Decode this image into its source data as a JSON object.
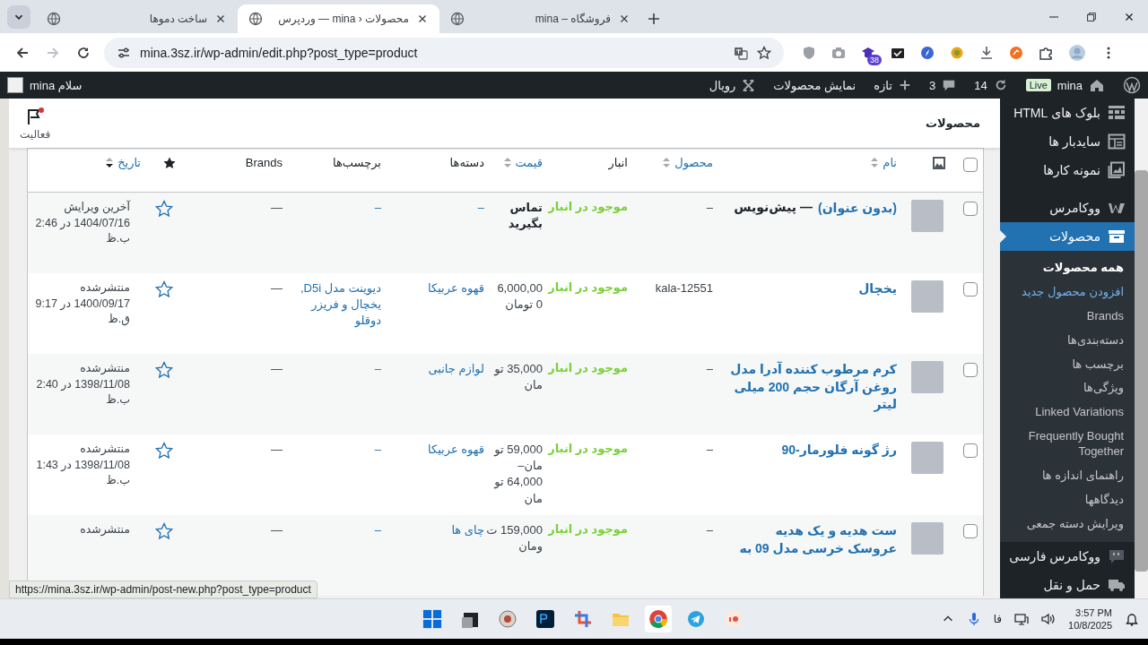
{
  "browser": {
    "tabs": [
      {
        "title": "فروشگاه – mina",
        "selected": false
      },
      {
        "title": "محصولات ‹ mina — وردپرس",
        "selected": true
      },
      {
        "title": "ساخت دموها",
        "selected": false
      }
    ],
    "url": "mina.3sz.ir/wp-admin/edit.php?post_type=product",
    "extension_badge": "38"
  },
  "admin_bar": {
    "site": "mina",
    "live": "Live",
    "updates": "14",
    "comments": "3",
    "new": "تازه",
    "view": "نمایش محصولات",
    "theme": "رویال",
    "greeting": "سلام mina"
  },
  "page": {
    "title": "محصولات",
    "activity": "فعالیت"
  },
  "table": {
    "columns": [
      {
        "kind": "checkbox",
        "checked": false
      },
      {
        "kind": "image"
      },
      {
        "kind": "sortable",
        "label": "نام"
      },
      {
        "kind": "sortable",
        "label": "محصول"
      },
      {
        "kind": "plain",
        "label": "انبار"
      },
      {
        "kind": "sortable",
        "label": "قیمت"
      },
      {
        "kind": "plain",
        "label": "دسته‌ها"
      },
      {
        "kind": "plain",
        "label": "برچسب‌ها"
      },
      {
        "kind": "plain",
        "label": "Brands"
      },
      {
        "kind": "star"
      },
      {
        "kind": "sorted",
        "label": "تاریخ"
      }
    ],
    "rows": [
      {
        "checked": false,
        "name": "(بدون عنوان)",
        "note": "— پیش‌نویس",
        "sku": "–",
        "stock": "موجود در انبار",
        "price": [
          "تماس",
          "بگیرید"
        ],
        "price_bold": true,
        "categories": "–",
        "tags": "–",
        "brands": "—",
        "featured": false,
        "date": [
          "آخرین ویرایش",
          "1404/07/16 در 2:46",
          "ب.ظ"
        ]
      },
      {
        "checked": false,
        "name": "یخچال",
        "sku": "kala-12551",
        "stock": "موجود در انبار",
        "price": [
          "6,000,00",
          "0 تومان"
        ],
        "price_bold": false,
        "categories": "قهوه عربیکا",
        "tags": "دیوینت مدل D5i, یخچال و فریزر دوقلو",
        "brands": "—",
        "featured": false,
        "date": [
          "منتشرشده",
          "1400/09/17 در 9:17",
          "ق.ظ"
        ]
      },
      {
        "checked": false,
        "name": "کرم مرطوب کننده آدرا مدل روغن آرگان حجم 200 میلی لیتر",
        "sku": "–",
        "stock": "موجود در انبار",
        "price": [
          "35,000 تو",
          "مان"
        ],
        "price_bold": false,
        "categories": "لوازم جانبی",
        "tags": "–",
        "brands": "—",
        "featured": false,
        "date": [
          "منتشرشده",
          "1398/11/08 در 2:40",
          "ب.ظ"
        ]
      },
      {
        "checked": false,
        "name": "رژ گونه فلورمار-90",
        "sku": "–",
        "stock": "موجود در انبار",
        "price": [
          "59,000 تو",
          "مان–",
          "64,000 تو",
          "مان"
        ],
        "price_bold": false,
        "categories": "قهوه عربیکا",
        "tags": "–",
        "brands": "—",
        "featured": false,
        "date": [
          "منتشرشده",
          "1398/11/08 در 1:43",
          "ب.ظ"
        ]
      },
      {
        "checked": false,
        "name": "ست هدیه و یک هدیه عروسک خرسی مدل 09 به",
        "sku": "–",
        "stock": "موجود در انبار",
        "price": [
          "159,000 ت",
          "ومان"
        ],
        "price_bold": false,
        "categories": "چای ها",
        "tags": "–",
        "brands": "—",
        "featured": false,
        "date": [
          "منتشرشده"
        ]
      }
    ]
  },
  "sidebar": {
    "items": [
      {
        "label": "بلوک های HTML",
        "selected": false
      },
      {
        "label": "سایدبار ها",
        "selected": false
      },
      {
        "label": "نمونه کارها",
        "selected": false
      },
      {
        "label": "ووکامرس",
        "selected": false
      },
      {
        "label": "محصولات",
        "selected": true,
        "children": [
          {
            "label": "همه محصولات",
            "selected": true,
            "hovered": false
          },
          {
            "label": "افزودن محصول جدید",
            "selected": false,
            "hovered": true
          },
          {
            "label": "Brands",
            "selected": false,
            "hovered": false
          },
          {
            "label": "دسته‌بندی‌ها",
            "selected": false,
            "hovered": false
          },
          {
            "label": "برچسب ها",
            "selected": false,
            "hovered": false
          },
          {
            "label": "ویژگی‌ها",
            "selected": false,
            "hovered": false
          },
          {
            "label": "Linked Variations",
            "selected": false,
            "hovered": false
          },
          {
            "label": "Frequently Bought Together",
            "selected": false,
            "hovered": false
          },
          {
            "label": "راهنمای اندازه ها",
            "selected": false,
            "hovered": false
          },
          {
            "label": "دیدگاهها",
            "selected": false,
            "hovered": false
          },
          {
            "label": "ویرایش دسته جمعی",
            "selected": false,
            "hovered": false
          }
        ]
      },
      {
        "label": "ووکامرس فارسی",
        "selected": false
      },
      {
        "label": "حمل و نقل",
        "selected": false
      }
    ]
  },
  "status_url": "https://mina.3sz.ir/wp-admin/post-new.php?post_type=product",
  "taskbar": {
    "language": "فا",
    "time": "3:57 PM",
    "date": "10/8/2025"
  }
}
